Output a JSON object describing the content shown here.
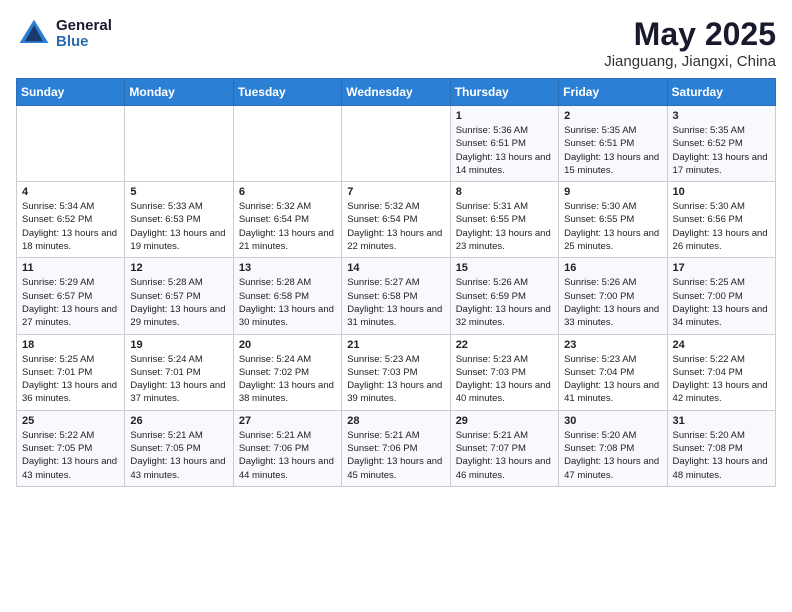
{
  "logo": {
    "general": "General",
    "blue": "Blue"
  },
  "title": "May 2025",
  "subtitle": "Jianguang, Jiangxi, China",
  "weekdays": [
    "Sunday",
    "Monday",
    "Tuesday",
    "Wednesday",
    "Thursday",
    "Friday",
    "Saturday"
  ],
  "weeks": [
    [
      {
        "day": "",
        "info": ""
      },
      {
        "day": "",
        "info": ""
      },
      {
        "day": "",
        "info": ""
      },
      {
        "day": "",
        "info": ""
      },
      {
        "day": "1",
        "info": "Sunrise: 5:36 AM\nSunset: 6:51 PM\nDaylight: 13 hours and 14 minutes."
      },
      {
        "day": "2",
        "info": "Sunrise: 5:35 AM\nSunset: 6:51 PM\nDaylight: 13 hours and 15 minutes."
      },
      {
        "day": "3",
        "info": "Sunrise: 5:35 AM\nSunset: 6:52 PM\nDaylight: 13 hours and 17 minutes."
      }
    ],
    [
      {
        "day": "4",
        "info": "Sunrise: 5:34 AM\nSunset: 6:52 PM\nDaylight: 13 hours and 18 minutes."
      },
      {
        "day": "5",
        "info": "Sunrise: 5:33 AM\nSunset: 6:53 PM\nDaylight: 13 hours and 19 minutes."
      },
      {
        "day": "6",
        "info": "Sunrise: 5:32 AM\nSunset: 6:54 PM\nDaylight: 13 hours and 21 minutes."
      },
      {
        "day": "7",
        "info": "Sunrise: 5:32 AM\nSunset: 6:54 PM\nDaylight: 13 hours and 22 minutes."
      },
      {
        "day": "8",
        "info": "Sunrise: 5:31 AM\nSunset: 6:55 PM\nDaylight: 13 hours and 23 minutes."
      },
      {
        "day": "9",
        "info": "Sunrise: 5:30 AM\nSunset: 6:55 PM\nDaylight: 13 hours and 25 minutes."
      },
      {
        "day": "10",
        "info": "Sunrise: 5:30 AM\nSunset: 6:56 PM\nDaylight: 13 hours and 26 minutes."
      }
    ],
    [
      {
        "day": "11",
        "info": "Sunrise: 5:29 AM\nSunset: 6:57 PM\nDaylight: 13 hours and 27 minutes."
      },
      {
        "day": "12",
        "info": "Sunrise: 5:28 AM\nSunset: 6:57 PM\nDaylight: 13 hours and 29 minutes."
      },
      {
        "day": "13",
        "info": "Sunrise: 5:28 AM\nSunset: 6:58 PM\nDaylight: 13 hours and 30 minutes."
      },
      {
        "day": "14",
        "info": "Sunrise: 5:27 AM\nSunset: 6:58 PM\nDaylight: 13 hours and 31 minutes."
      },
      {
        "day": "15",
        "info": "Sunrise: 5:26 AM\nSunset: 6:59 PM\nDaylight: 13 hours and 32 minutes."
      },
      {
        "day": "16",
        "info": "Sunrise: 5:26 AM\nSunset: 7:00 PM\nDaylight: 13 hours and 33 minutes."
      },
      {
        "day": "17",
        "info": "Sunrise: 5:25 AM\nSunset: 7:00 PM\nDaylight: 13 hours and 34 minutes."
      }
    ],
    [
      {
        "day": "18",
        "info": "Sunrise: 5:25 AM\nSunset: 7:01 PM\nDaylight: 13 hours and 36 minutes."
      },
      {
        "day": "19",
        "info": "Sunrise: 5:24 AM\nSunset: 7:01 PM\nDaylight: 13 hours and 37 minutes."
      },
      {
        "day": "20",
        "info": "Sunrise: 5:24 AM\nSunset: 7:02 PM\nDaylight: 13 hours and 38 minutes."
      },
      {
        "day": "21",
        "info": "Sunrise: 5:23 AM\nSunset: 7:03 PM\nDaylight: 13 hours and 39 minutes."
      },
      {
        "day": "22",
        "info": "Sunrise: 5:23 AM\nSunset: 7:03 PM\nDaylight: 13 hours and 40 minutes."
      },
      {
        "day": "23",
        "info": "Sunrise: 5:23 AM\nSunset: 7:04 PM\nDaylight: 13 hours and 41 minutes."
      },
      {
        "day": "24",
        "info": "Sunrise: 5:22 AM\nSunset: 7:04 PM\nDaylight: 13 hours and 42 minutes."
      }
    ],
    [
      {
        "day": "25",
        "info": "Sunrise: 5:22 AM\nSunset: 7:05 PM\nDaylight: 13 hours and 43 minutes."
      },
      {
        "day": "26",
        "info": "Sunrise: 5:21 AM\nSunset: 7:05 PM\nDaylight: 13 hours and 43 minutes."
      },
      {
        "day": "27",
        "info": "Sunrise: 5:21 AM\nSunset: 7:06 PM\nDaylight: 13 hours and 44 minutes."
      },
      {
        "day": "28",
        "info": "Sunrise: 5:21 AM\nSunset: 7:06 PM\nDaylight: 13 hours and 45 minutes."
      },
      {
        "day": "29",
        "info": "Sunrise: 5:21 AM\nSunset: 7:07 PM\nDaylight: 13 hours and 46 minutes."
      },
      {
        "day": "30",
        "info": "Sunrise: 5:20 AM\nSunset: 7:08 PM\nDaylight: 13 hours and 47 minutes."
      },
      {
        "day": "31",
        "info": "Sunrise: 5:20 AM\nSunset: 7:08 PM\nDaylight: 13 hours and 48 minutes."
      }
    ]
  ]
}
